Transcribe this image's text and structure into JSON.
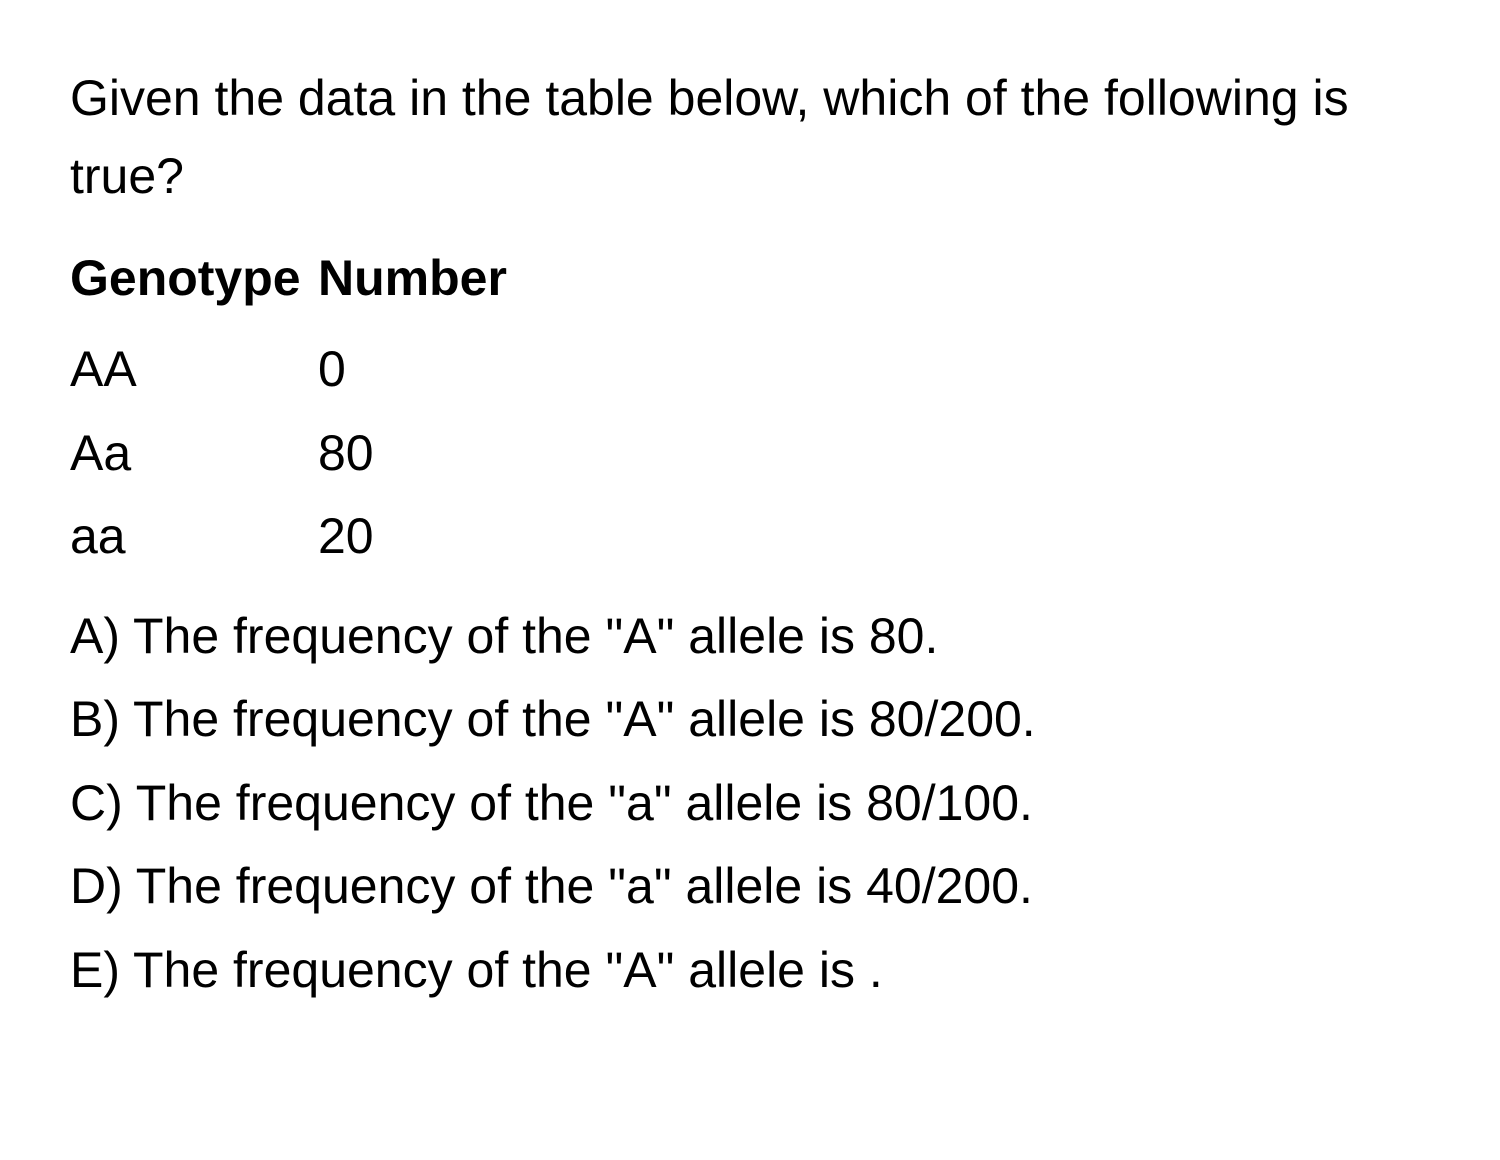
{
  "question": {
    "prompt": "Given the data in the table below, which of the following is true?"
  },
  "table": {
    "headers": {
      "genotype": "Genotype",
      "number": "Number"
    },
    "rows": [
      {
        "genotype": "AA",
        "number": "0"
      },
      {
        "genotype": "Aa",
        "number": "80"
      },
      {
        "genotype": "aa",
        "number": "20"
      }
    ]
  },
  "options": [
    {
      "text": "A) The frequency of the \"A\" allele is 80."
    },
    {
      "text": "B) The frequency of the \"A\" allele is 80/200."
    },
    {
      "text": "C) The frequency of the \"a\" allele is 80/100."
    },
    {
      "text": "D) The frequency of the \"a\" allele is 40/200."
    },
    {
      "text": "E) The frequency of the \"A\" allele is ."
    }
  ]
}
